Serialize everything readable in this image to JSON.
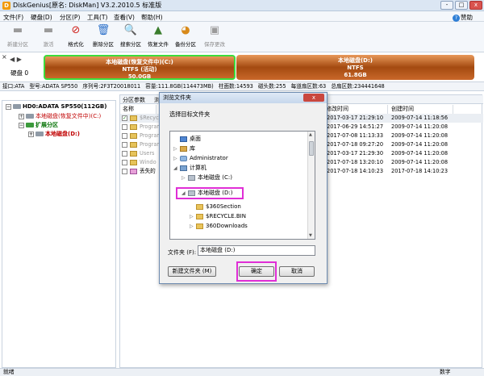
{
  "window": {
    "title": "DiskGenius[原名: DiskMan] V3.2.2010.5 标准版",
    "controls": [
      "-",
      "□",
      "x"
    ]
  },
  "menu": {
    "items": [
      "文件(F)",
      "硬盘(D)",
      "分区(P)",
      "工具(T)",
      "查看(V)",
      "帮助(H)"
    ],
    "help_label": "赞助"
  },
  "toolbar": {
    "buttons": [
      {
        "label": "新建分区",
        "icon": "new-partition-icon",
        "glyph": "▬",
        "disabled": true
      },
      {
        "label": "激活",
        "icon": "activate-icon",
        "glyph": "▬",
        "disabled": true
      },
      {
        "label": "格式化",
        "icon": "format-icon",
        "glyph": "⊘",
        "disabled": false
      },
      {
        "label": "删除分区",
        "icon": "delete-partition-icon",
        "glyph": "🗑",
        "disabled": false
      },
      {
        "label": "搜索分区",
        "icon": "search-partition-icon",
        "glyph": "🔍",
        "disabled": false
      },
      {
        "label": "恢复文件",
        "icon": "recover-file-icon",
        "glyph": "▲",
        "disabled": false
      },
      {
        "label": "备份分区",
        "icon": "backup-partition-icon",
        "glyph": "◕",
        "disabled": false
      },
      {
        "label": "保存更改",
        "icon": "save-changes-icon",
        "glyph": "▣",
        "disabled": true
      }
    ]
  },
  "diskmap": {
    "disk_label": "硬盘 0",
    "partitions": [
      {
        "name": "本地磁盘(恢复文件中)(C:)",
        "fs": "NTFS (活动)",
        "size": "50.0GB",
        "selected": true
      },
      {
        "name": "本地磁盘(D:)",
        "fs": "NTFS",
        "size": "61.8GB",
        "selected": false
      }
    ]
  },
  "infobar": {
    "fields": [
      "接口:ATA",
      "型号:ADATA SP550",
      "序列号:2F3T20018011",
      "容量:111.8GB(114473MB)",
      "柱面数:14593",
      "磁头数:255",
      "每道扇区数:63",
      "总扇区数:234441648"
    ]
  },
  "tree": {
    "disk": "HD0:ADATA SP550(112GB)",
    "c_partition": "本地磁盘(恢复文件中)(C:)",
    "extended": "扩展分区",
    "d_partition": "本地磁盘(D:)"
  },
  "content": {
    "tabs": [
      "分区参数",
      "浏"
    ],
    "columns": [
      "名称",
      "修改时间",
      "创建时间"
    ],
    "rows": [
      {
        "name": "$Recyc",
        "modified": "2017-03-17 21:29:10",
        "created": "2009-07-14 11:18:56",
        "checked": true,
        "selected": true
      },
      {
        "name": "Program",
        "modified": "2017-06-29 14:51:27",
        "created": "2009-07-14 11:20:08",
        "checked": false,
        "selected": false
      },
      {
        "name": "Program",
        "modified": "2017-07-08 11:13:33",
        "created": "2009-07-14 11:20:08",
        "checked": false,
        "selected": false
      },
      {
        "name": "Program",
        "modified": "2017-07-18 09:27:20",
        "created": "2009-07-14 11:20:08",
        "checked": false,
        "selected": false
      },
      {
        "name": "Users",
        "modified": "2017-03-17 21:29:30",
        "created": "2009-07-14 11:20:08",
        "checked": false,
        "selected": false
      },
      {
        "name": "Windo",
        "modified": "2017-07-18 13:20:10",
        "created": "2009-07-14 11:20:08",
        "checked": false,
        "selected": false
      },
      {
        "name": "丢失的",
        "modified": "2017-07-18 14:10:23",
        "created": "2017-07-18 14:10:23",
        "checked": false,
        "selected": false
      }
    ]
  },
  "dialog": {
    "title": "浏览文件夹",
    "close": "x",
    "prompt": "选择目标文件夹",
    "folders": [
      {
        "label": "桌面",
        "icon": "desktop"
      },
      {
        "label": "库",
        "icon": "lib"
      },
      {
        "label": "Administrator",
        "icon": "user"
      },
      {
        "label": "计算机",
        "icon": "pc"
      },
      {
        "label": "本地磁盘 (C:)",
        "icon": "drive"
      },
      {
        "label": "本地磁盘 (D:)",
        "icon": "drive"
      },
      {
        "label": "$360Section",
        "icon": "folder"
      },
      {
        "label": "$RECYCLE.BIN",
        "icon": "folder"
      },
      {
        "label": "360Downloads",
        "icon": "folder"
      }
    ],
    "folder_field_label": "文件夹 (F):",
    "folder_field_value": "本地磁盘 (D:)",
    "new_folder_label": "新建文件夹 (M)",
    "ok_label": "确定",
    "cancel_label": "取消"
  },
  "status": {
    "left": "就绪",
    "mode": "数字"
  }
}
